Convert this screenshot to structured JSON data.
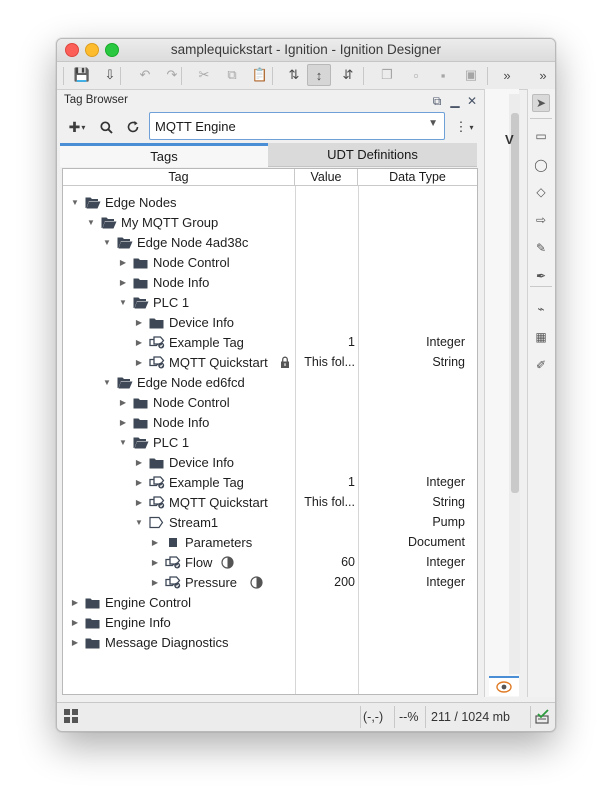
{
  "window": {
    "title": "samplequickstart - Ignition - Ignition Designer"
  },
  "toolbar": {
    "overflow_label": "»",
    "items": [
      {
        "icon": "save-icon",
        "glyph": "💾"
      },
      {
        "icon": "save-download-icon",
        "glyph": "⇩"
      },
      {
        "icon": "undo-icon",
        "glyph": "↶"
      },
      {
        "icon": "redo-icon",
        "glyph": "↷"
      },
      {
        "icon": "cut-icon",
        "glyph": "✂"
      },
      {
        "icon": "copy-icon",
        "glyph": "⧉"
      },
      {
        "icon": "paste-icon",
        "glyph": "📋"
      },
      {
        "icon": "bind-icon",
        "glyph": "⇅"
      },
      {
        "icon": "snap-icon",
        "glyph": "↕"
      },
      {
        "icon": "push-icon",
        "glyph": "⇵"
      },
      {
        "icon": "group-icon",
        "glyph": "❐"
      },
      {
        "icon": "ungroup-icon",
        "glyph": "▫"
      },
      {
        "icon": "bring-front-icon",
        "glyph": "▪"
      },
      {
        "icon": "send-back-icon",
        "glyph": "▣"
      }
    ]
  },
  "tag_browser": {
    "title": "Tag Browser",
    "provider": "MQTT Engine",
    "tabs": [
      "Tags",
      "UDT Definitions"
    ],
    "columns": [
      "Tag",
      "Value",
      "Data Type"
    ],
    "rows": [
      {
        "depth": 0,
        "twisty": "open",
        "icon": "folder-open",
        "label": "Edge Nodes",
        "value": "",
        "type": ""
      },
      {
        "depth": 1,
        "twisty": "open",
        "icon": "folder-open",
        "label": "My MQTT Group",
        "value": "",
        "type": ""
      },
      {
        "depth": 2,
        "twisty": "open",
        "icon": "folder-open",
        "label": "Edge Node 4ad38c",
        "value": "",
        "type": ""
      },
      {
        "depth": 3,
        "twisty": "closed",
        "icon": "folder",
        "label": "Node Control",
        "value": "",
        "type": ""
      },
      {
        "depth": 3,
        "twisty": "closed",
        "icon": "folder",
        "label": "Node Info",
        "value": "",
        "type": ""
      },
      {
        "depth": 3,
        "twisty": "open",
        "icon": "folder-open",
        "label": "PLC 1",
        "value": "",
        "type": ""
      },
      {
        "depth": 4,
        "twisty": "closed",
        "icon": "folder",
        "label": "Device Info",
        "value": "",
        "type": ""
      },
      {
        "depth": 4,
        "twisty": "closed",
        "icon": "tag",
        "label": "Example Tag",
        "value": "1",
        "type": "Integer"
      },
      {
        "depth": 4,
        "twisty": "closed",
        "icon": "tag",
        "label": "MQTT Quickstart",
        "value": "This fol...",
        "type": "String",
        "extra": "lock-icon"
      },
      {
        "depth": 2,
        "twisty": "open",
        "icon": "folder-open",
        "label": "Edge Node ed6fcd",
        "value": "",
        "type": ""
      },
      {
        "depth": 3,
        "twisty": "closed",
        "icon": "folder",
        "label": "Node Control",
        "value": "",
        "type": ""
      },
      {
        "depth": 3,
        "twisty": "closed",
        "icon": "folder",
        "label": "Node Info",
        "value": "",
        "type": ""
      },
      {
        "depth": 3,
        "twisty": "open",
        "icon": "folder-open",
        "label": "PLC 1",
        "value": "",
        "type": ""
      },
      {
        "depth": 4,
        "twisty": "closed",
        "icon": "folder",
        "label": "Device Info",
        "value": "",
        "type": ""
      },
      {
        "depth": 4,
        "twisty": "closed",
        "icon": "tag",
        "label": "Example Tag",
        "value": "1",
        "type": "Integer"
      },
      {
        "depth": 4,
        "twisty": "closed",
        "icon": "tag",
        "label": "MQTT Quickstart",
        "value": "This fol...",
        "type": "String"
      },
      {
        "depth": 4,
        "twisty": "open",
        "icon": "udt-instance",
        "label": "Stream1",
        "value": "",
        "type": "Pump"
      },
      {
        "depth": 5,
        "twisty": "closed",
        "icon": "document",
        "label": "Parameters",
        "value": "",
        "type": "Document"
      },
      {
        "depth": 5,
        "twisty": "closed",
        "icon": "tag",
        "label": "Flow",
        "value": "60",
        "type": "Integer",
        "extra": "override-icon"
      },
      {
        "depth": 5,
        "twisty": "closed",
        "icon": "tag",
        "label": "Pressure",
        "value": "200",
        "type": "Integer",
        "extra": "override-icon"
      },
      {
        "depth": 0,
        "twisty": "closed",
        "icon": "folder",
        "label": "Engine Control",
        "value": "",
        "type": ""
      },
      {
        "depth": 0,
        "twisty": "closed",
        "icon": "folder",
        "label": "Engine Info",
        "value": "",
        "type": ""
      },
      {
        "depth": 0,
        "twisty": "closed",
        "icon": "folder",
        "label": "Message Diagnostics",
        "value": "",
        "type": ""
      }
    ]
  },
  "side_panel": {
    "collapsed_text": "V"
  },
  "tools": [
    "pointer-icon",
    "comment-icon",
    "lasso-icon",
    "fill-icon",
    "arrow-icon",
    "pencil-icon",
    "pen-icon",
    "node-icon",
    "gradient-icon",
    "eyedropper-icon"
  ],
  "status": {
    "coords": "(-,-)",
    "zoom": "--%",
    "memory": "211 / 1024 mb"
  },
  "colors": {
    "accent": "#4a8fd6",
    "folder": "#3e4756"
  }
}
